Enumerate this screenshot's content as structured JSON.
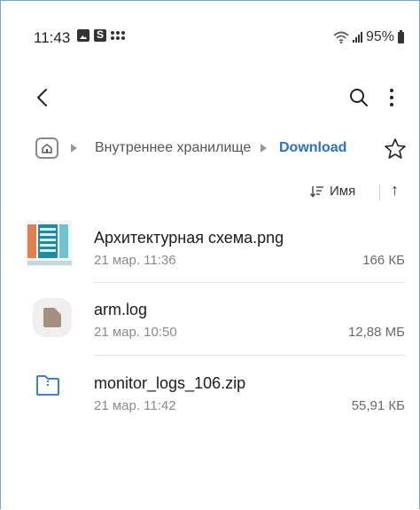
{
  "status_bar": {
    "time": "11:43",
    "battery": "95%",
    "left_icons": [
      "image-notification-icon",
      "s-app-icon",
      "dots-grid-icon"
    ],
    "right_icons": [
      "wifi-icon",
      "signal-icon",
      "battery-icon"
    ]
  },
  "toolbar": {
    "icons": [
      "back-arrow-icon",
      "search-icon",
      "more-vert-icon"
    ]
  },
  "breadcrumb": {
    "items": [
      "Внутреннее хранилище",
      "Download"
    ]
  },
  "sort": {
    "label": "Имя",
    "direction": "↑"
  },
  "files": [
    {
      "name": "Архитектурная схема.png",
      "date": "21 мар. 11:36",
      "size": "166 КБ",
      "icon": "image-thumbnail"
    },
    {
      "name": "arm.log",
      "date": "21 мар. 10:50",
      "size": "12,88 МБ",
      "icon": "document-icon"
    },
    {
      "name": "monitor_logs_106.zip",
      "date": "21 мар. 11:42",
      "size": "55,91 КБ",
      "icon": "zip-folder-icon"
    }
  ],
  "colors": {
    "accent": "#2a6fc9",
    "frame_border": "#6ea7d8"
  }
}
